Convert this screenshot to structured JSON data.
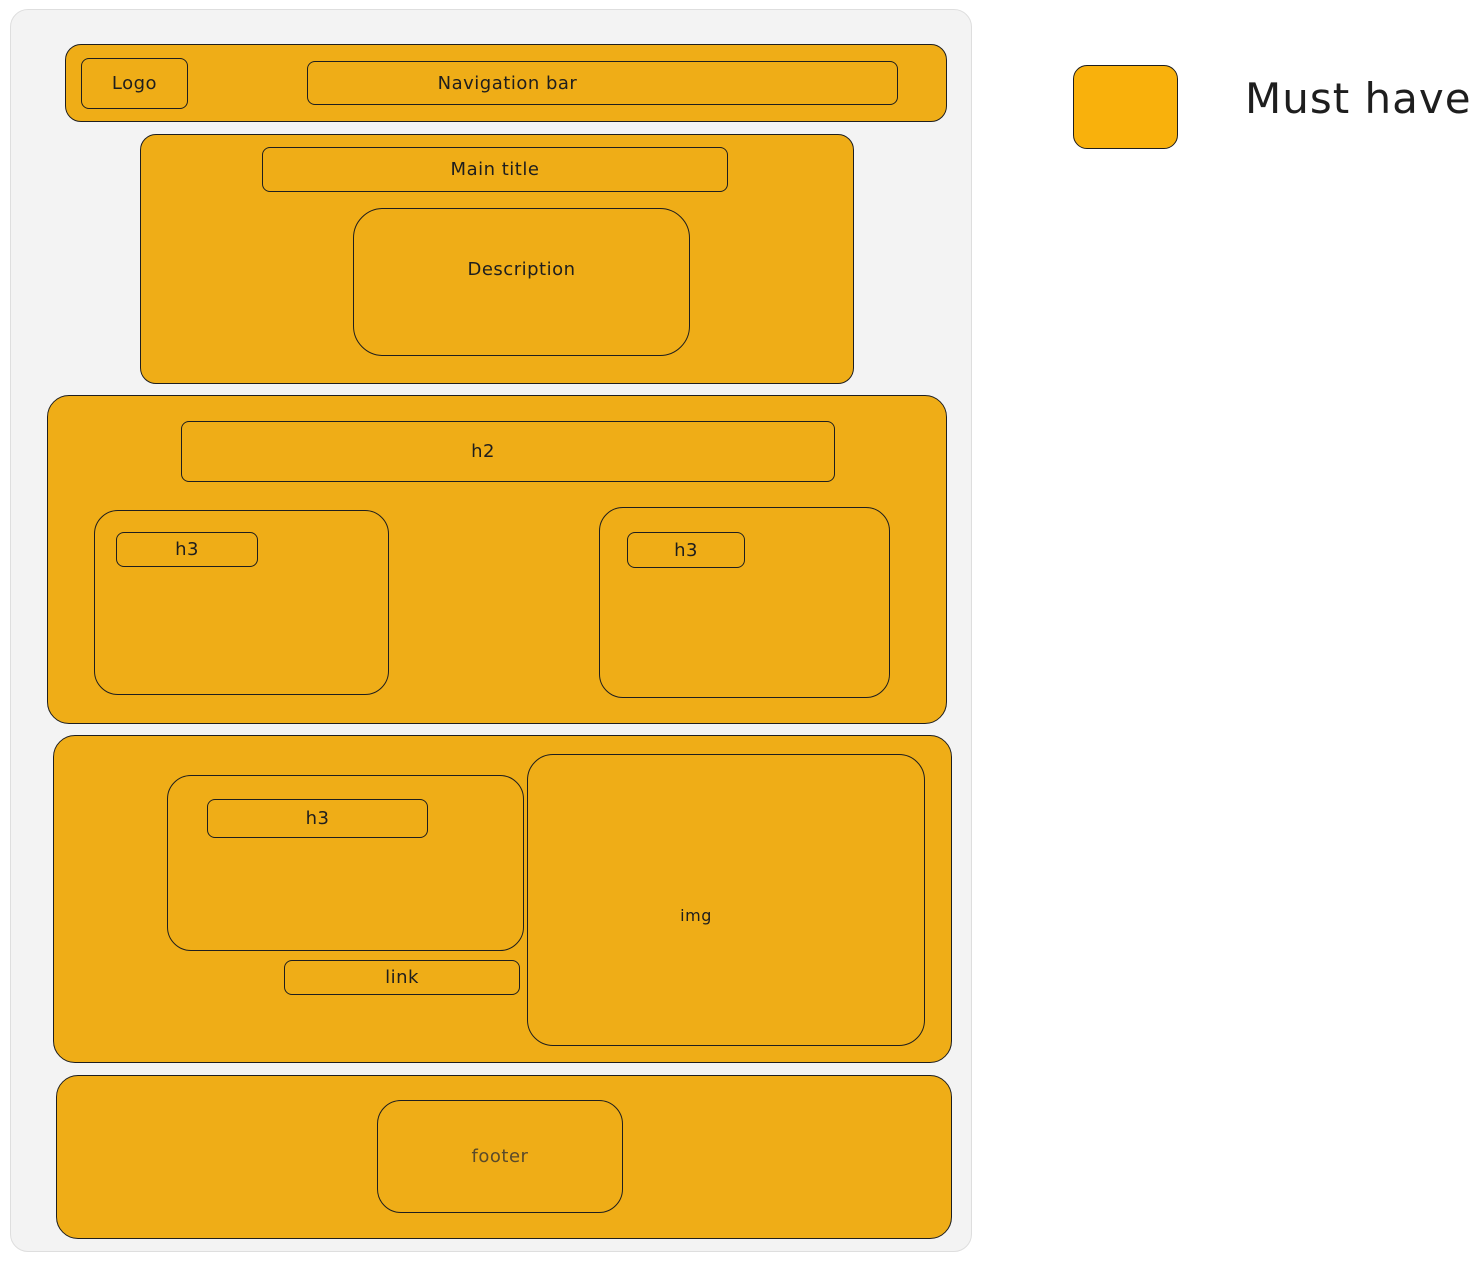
{
  "colors": {
    "must_have_fill": "#efad17",
    "legend_fill": "#f9b10c",
    "frame_bg": "#f3f3f3",
    "stroke": "#1e1e1e"
  },
  "header": {
    "logo_label": "Logo",
    "nav_label": "Navigation bar"
  },
  "hero": {
    "title_label": "Main title",
    "description_label": "Description"
  },
  "section_one": {
    "h2_label": "h2",
    "card_left_h3": "h3",
    "card_right_h3": "h3"
  },
  "section_two": {
    "card_h3": "h3",
    "link_label": "link",
    "img_label": "img"
  },
  "footer": {
    "label": "footer"
  },
  "legend": {
    "label": "Must have"
  }
}
